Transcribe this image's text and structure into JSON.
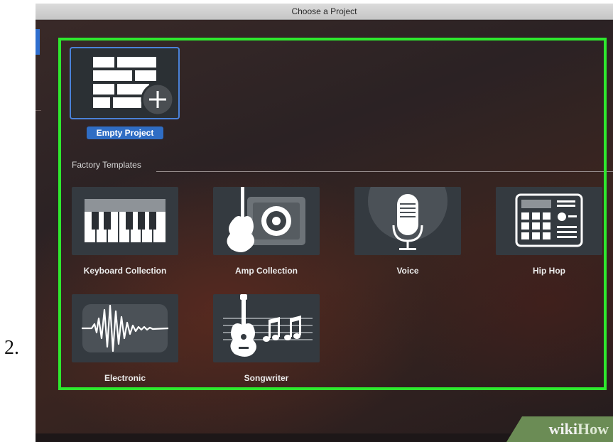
{
  "step": {
    "number": "2."
  },
  "window": {
    "title": "Choose a Project"
  },
  "empty_project": {
    "label": "Empty Project",
    "icon": "brick-wall-plus-icon"
  },
  "factory_templates": {
    "heading": "Factory Templates",
    "items": [
      {
        "label": "Keyboard Collection",
        "icon": "piano-keyboard-icon"
      },
      {
        "label": "Amp Collection",
        "icon": "guitar-amp-icon"
      },
      {
        "label": "Voice",
        "icon": "microphone-icon"
      },
      {
        "label": "Hip Hop",
        "icon": "drum-machine-icon"
      },
      {
        "label": "Electronic",
        "icon": "waveform-icon"
      },
      {
        "label": "Songwriter",
        "icon": "acoustic-guitar-notes-icon"
      }
    ]
  },
  "watermark": {
    "part1": "wiki",
    "part2": "How"
  },
  "colors": {
    "highlight": "#2ee82e",
    "selection": "#2f6dc4",
    "tile": "#343a40",
    "watermark": "#6b8c55"
  }
}
